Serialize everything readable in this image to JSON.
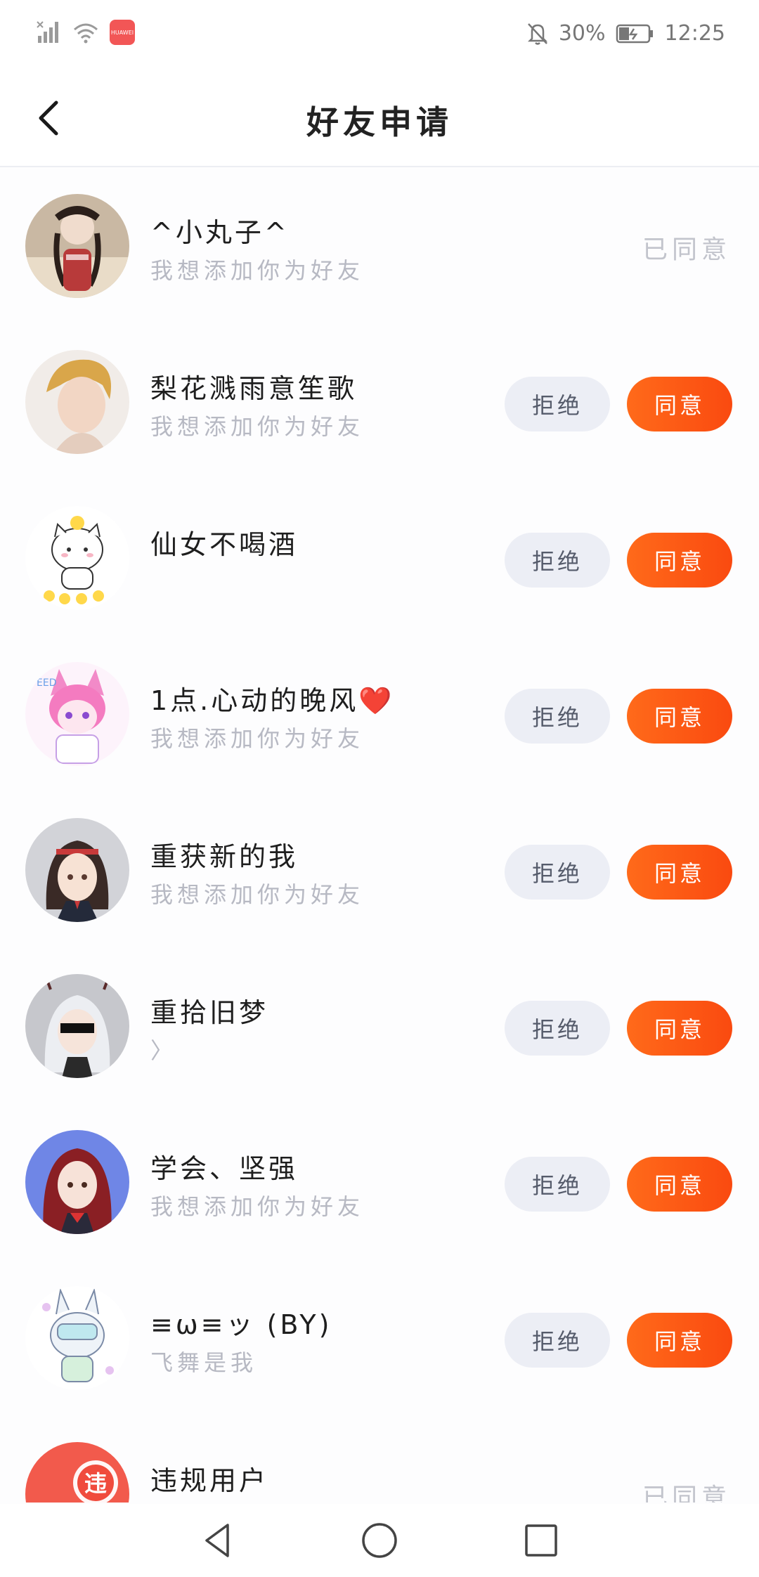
{
  "statusbar": {
    "app_badge": "HUAWEI",
    "battery": "30%",
    "time": "12:25",
    "icons": [
      "signal-icon",
      "wifi-icon",
      "app-notification-icon",
      "silent-bell-icon",
      "battery-charging-icon"
    ]
  },
  "header": {
    "title": "好友申请",
    "back_icon": "back-arrow-icon"
  },
  "colors": {
    "accent": "#fa5514",
    "reject_bg": "#eceef5",
    "muted_text": "#b7b9c3"
  },
  "requests": [
    {
      "name": "^小丸子^",
      "message": "我想添加你为好友",
      "status": "已同意",
      "avatar": "girl-with-hat-photo"
    },
    {
      "name": "梨花溅雨意笙歌",
      "message": "我想添加你为好友",
      "reject": "拒绝",
      "agree": "同意",
      "avatar": "blond-boy-portrait"
    },
    {
      "name": "仙女不喝酒",
      "message": "",
      "reject": "拒绝",
      "agree": "同意",
      "avatar": "cartoon-cat-with-chicks"
    },
    {
      "name": "1点.心动的晚风❤️",
      "message": "我想添加你为好友",
      "reject": "拒绝",
      "agree": "同意",
      "avatar": "pink-anime-cat-girl"
    },
    {
      "name": "重获新的我",
      "message": "我想添加你为好友",
      "reject": "拒绝",
      "agree": "同意",
      "avatar": "anime-girl-red-headband"
    },
    {
      "name": "重拾旧梦",
      "message": "〉",
      "reject": "拒绝",
      "agree": "同意",
      "avatar": "anime-girl-sunglasses"
    },
    {
      "name": "学会、坚强",
      "message": "我想添加你为好友",
      "reject": "拒绝",
      "agree": "同意",
      "avatar": "anime-girl-red-hair-blue-bg"
    },
    {
      "name": "≡ω≡ッ (BY)",
      "message": "飞舞是我",
      "reject": "拒绝",
      "agree": "同意",
      "avatar": "sketch-bunny-robot"
    },
    {
      "name": "违规用户",
      "message": "",
      "status": "已同意",
      "avatar": "violation-badge",
      "avatar_text": "违"
    }
  ],
  "navbar": {
    "icons": [
      "nav-back-icon",
      "nav-home-icon",
      "nav-recent-icon"
    ]
  }
}
